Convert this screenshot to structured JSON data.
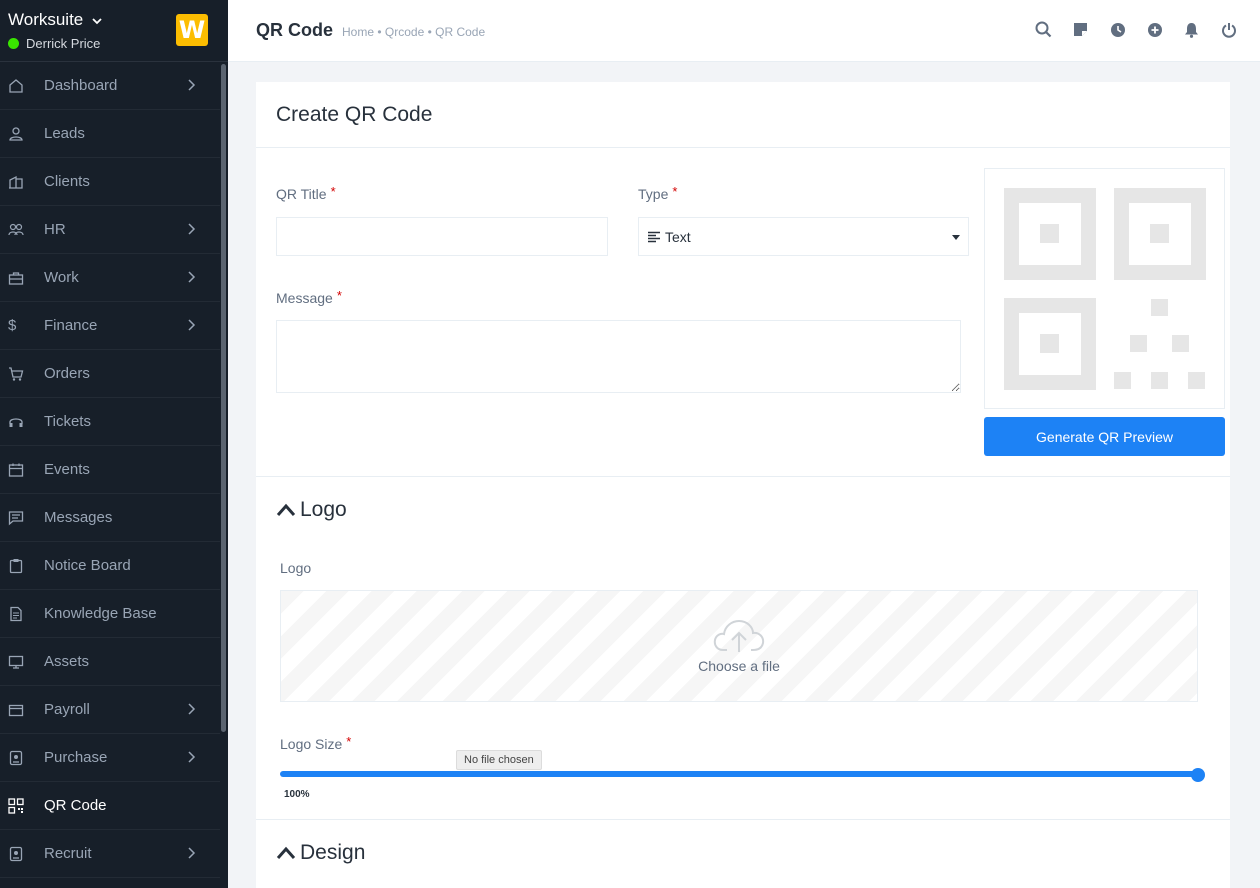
{
  "sidebar": {
    "brand": "Worksuite",
    "user": "Derrick Price",
    "logo_letter": "W",
    "items": [
      {
        "label": "Dashboard",
        "icon": "home-icon",
        "arrow": true
      },
      {
        "label": "Leads",
        "icon": "user-icon",
        "arrow": false
      },
      {
        "label": "Clients",
        "icon": "building-icon",
        "arrow": false
      },
      {
        "label": "HR",
        "icon": "people-icon",
        "arrow": true
      },
      {
        "label": "Work",
        "icon": "briefcase-icon",
        "arrow": true
      },
      {
        "label": "Finance",
        "icon": "dollar-icon",
        "arrow": true
      },
      {
        "label": "Orders",
        "icon": "cart-icon",
        "arrow": false
      },
      {
        "label": "Tickets",
        "icon": "headset-icon",
        "arrow": false
      },
      {
        "label": "Events",
        "icon": "calendar-icon",
        "arrow": false
      },
      {
        "label": "Messages",
        "icon": "chat-icon",
        "arrow": false
      },
      {
        "label": "Notice Board",
        "icon": "clipboard-icon",
        "arrow": false
      },
      {
        "label": "Knowledge Base",
        "icon": "document-icon",
        "arrow": false
      },
      {
        "label": "Assets",
        "icon": "monitor-icon",
        "arrow": false
      },
      {
        "label": "Payroll",
        "icon": "wallet-icon",
        "arrow": true
      },
      {
        "label": "Purchase",
        "icon": "badge-icon",
        "arrow": true
      },
      {
        "label": "QR Code",
        "icon": "qr-icon",
        "arrow": false
      },
      {
        "label": "Recruit",
        "icon": "id-card-icon",
        "arrow": true
      }
    ]
  },
  "header": {
    "title": "QR Code",
    "breadcrumb": "Home • Qrcode • QR Code",
    "icons": [
      "search-icon",
      "sticky-note-icon",
      "clock-icon",
      "plus-circle-icon",
      "bell-icon",
      "power-icon"
    ]
  },
  "form": {
    "card_title": "Create QR Code",
    "qr_title_label": "QR Title",
    "qr_title_value": "",
    "type_label": "Type",
    "type_value": "Text",
    "message_label": "Message",
    "message_value": "",
    "generate_button": "Generate QR Preview"
  },
  "logo_section": {
    "heading": "Logo",
    "logo_label": "Logo",
    "dropzone_text": "Choose a file",
    "size_label": "Logo Size",
    "size_value": "100%",
    "tooltip": "No file chosen"
  },
  "design_section": {
    "heading": "Design"
  },
  "colors": {
    "sidebar_bg": "#171f29",
    "accent": "#1d82f5",
    "brand_yellow": "#fcbd01",
    "online_green": "#39e500"
  }
}
